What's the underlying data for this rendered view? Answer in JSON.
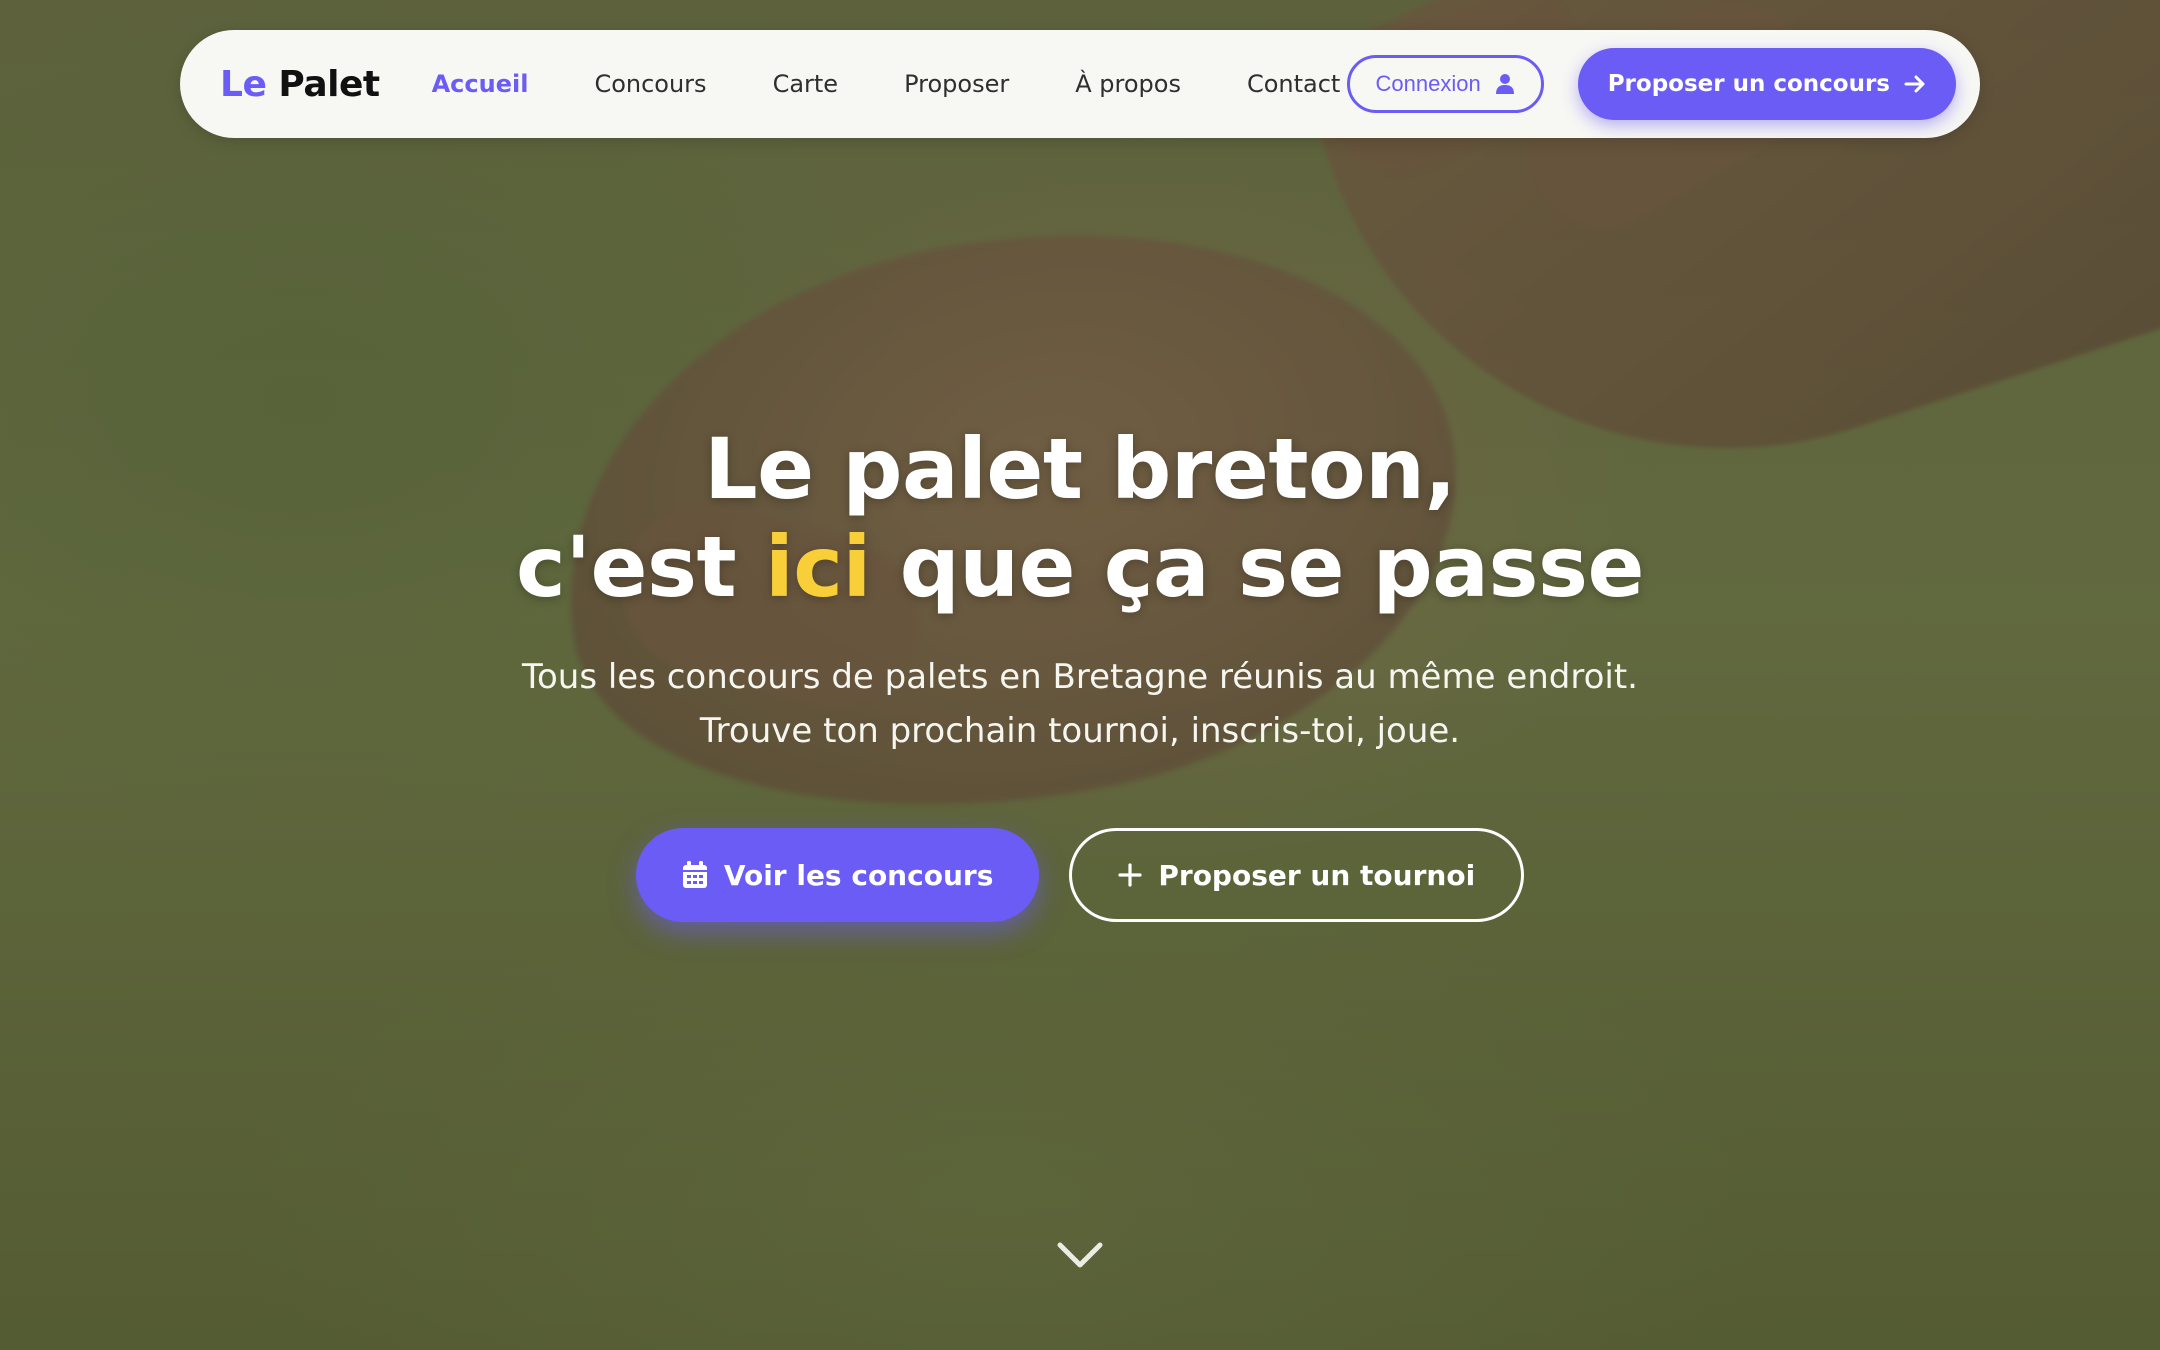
{
  "nav": {
    "logo_le": "Le",
    "logo_palet": "Palet",
    "links": [
      "Accueil",
      "Concours",
      "Carte",
      "Proposer",
      "À propos",
      "Contact"
    ],
    "active_index": 0,
    "login_label": "Connexion",
    "login_icon": "user-icon",
    "cta_label": "Proposer un concours",
    "cta_icon": "arrow-right-icon"
  },
  "hero": {
    "title_line1": "Le palet breton,",
    "title_line2_before": "c'est",
    "title_line2_highlight": "ici",
    "title_line2_after": "que ça se passe",
    "subtitle_line1": "Tous les concours de palets en Bretagne réunis au même endroit.",
    "subtitle_line2": "Trouve ton prochain tournoi, inscris-toi, joue.",
    "primary_label": "Voir les concours",
    "primary_icon": "calendar-icon",
    "secondary_label": "Proposer un tournoi",
    "secondary_icon": "plus-icon",
    "scroll_icon": "chevron-down-icon"
  },
  "colors": {
    "accent": "#6b5cf6",
    "highlight": "#f8cf39",
    "nav_bg": "#f7f7f4"
  }
}
